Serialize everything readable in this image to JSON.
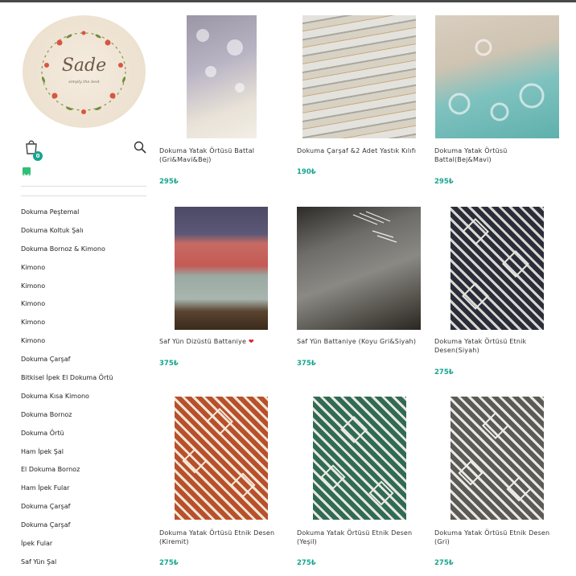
{
  "brand": {
    "logo_title": "Sade",
    "logo_subtitle": "simply the best"
  },
  "header": {
    "cart_count": "0",
    "accent_color": "#16a58e"
  },
  "icons": [
    "cart-icon",
    "search-icon",
    "mail-icon"
  ],
  "menu": [
    "Dokuma Peştemal",
    "Dokuma Koltuk Şalı",
    "Dokuma Bornoz & Kimono",
    "Kimono",
    "Kimono",
    "Kimono",
    "Kimono",
    "Kimono",
    "Dokuma Çarşaf",
    "Bitkisel İpek El Dokuma Örtü",
    "Dokuma Kısa Kimono",
    "Dokuma Bornoz",
    "Dokuma Örtü",
    "Ham İpek Şal",
    "El Dokuma Bornoz",
    "Ham İpek Fular",
    "Dokuma Çarşaf",
    "Dokuma Çarşaf",
    "İpek Fular",
    "Saf Yün Şal"
  ],
  "products": [
    {
      "name": "Dokuma Yatak Örtüsü Battal (Gri&Mavi&Bej)",
      "price": "295₺"
    },
    {
      "name": "Dokuma Çarşaf &2 Adet Yastık Kılıfı",
      "price": "190₺"
    },
    {
      "name": "Dokuma Yatak Örtüsü Battal(Bej&Mavi)",
      "price": "295₺"
    },
    {
      "name": "Saf Yün Dizüstü Battaniye",
      "heart": "❤",
      "price": "375₺"
    },
    {
      "name": "Saf Yün Battaniye (Koyu Gri&Siyah)",
      "price": "375₺"
    },
    {
      "name": "Dokuma Yatak Örtüsü Etnik Desen(Siyah)",
      "price": "275₺"
    },
    {
      "name": "Dokuma Yatak Örtüsü Etnik Desen (Kiremit)",
      "price": "275₺"
    },
    {
      "name": "Dokuma Yatak Örtüsü Etnik Desen (Yeşil)",
      "price": "275₺"
    },
    {
      "name": "Dokuma Yatak Örtüsü Etnik Desen (Gri)",
      "price": "275₺"
    }
  ]
}
